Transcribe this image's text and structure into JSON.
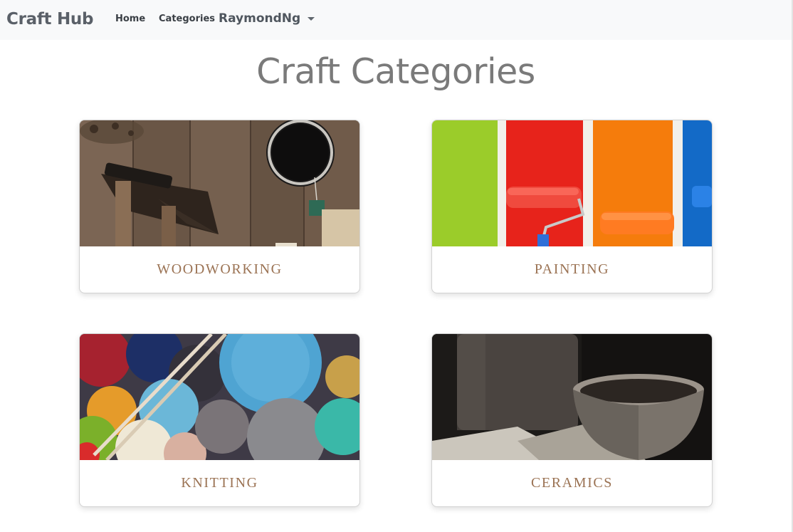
{
  "nav": {
    "brand": "Craft Hub",
    "links": [
      "Home",
      "Categories"
    ],
    "user": "RaymondNg"
  },
  "page": {
    "title": "Craft Categories"
  },
  "categories": [
    {
      "label": "WOODWORKING"
    },
    {
      "label": "PAINTING"
    },
    {
      "label": "KNITTING"
    },
    {
      "label": "CERAMICS"
    }
  ],
  "colors": {
    "navbar_bg": "#f8f9fa",
    "title_color": "#7a7a7a",
    "category_label_color": "#9b7354"
  }
}
